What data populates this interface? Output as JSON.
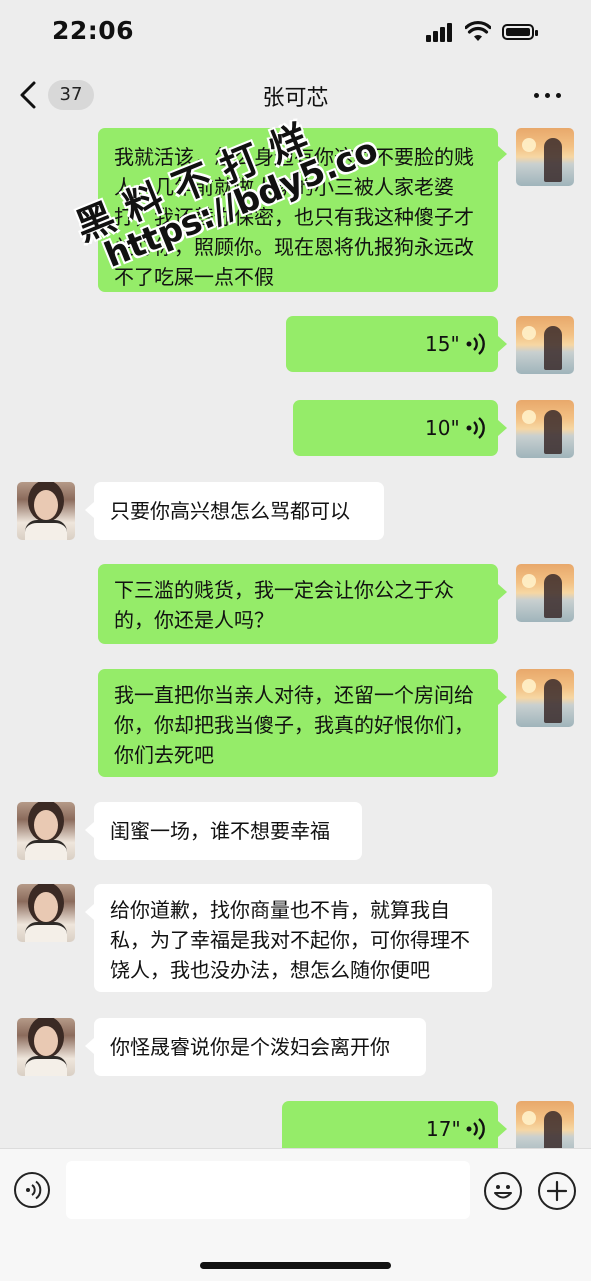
{
  "status_bar": {
    "time": "22:06"
  },
  "nav": {
    "unread_count": "37",
    "title": "张可芯"
  },
  "watermark": {
    "line1": "黑料不打烊",
    "line2": "https://bdy5.co"
  },
  "messages": [
    {
      "sender": "self",
      "type": "text",
      "text": "我就活该，怎么身边有你这种不要脸的贱人，几年前就做人家的小三被人家老婆打，我还替你保密，也只有我这种傻子才关心你，照顾你。现在恩将仇报狗永远改不了吃屎一点不假"
    },
    {
      "sender": "self",
      "type": "voice",
      "duration": "15\""
    },
    {
      "sender": "self",
      "type": "voice",
      "duration": "10\""
    },
    {
      "sender": "other",
      "type": "text",
      "text": "只要你高兴想怎么骂都可以"
    },
    {
      "sender": "self",
      "type": "text",
      "text": "下三滥的贱货，我一定会让你公之于众的，你还是人吗？"
    },
    {
      "sender": "self",
      "type": "text",
      "text": "我一直把你当亲人对待，还留一个房间给你，你却把我当傻子，我真的好恨你们，你们去死吧"
    },
    {
      "sender": "other",
      "type": "text",
      "text": "闺蜜一场，谁不想要幸福"
    },
    {
      "sender": "other",
      "type": "text",
      "text": "给你道歉，找你商量也不肯，就算我自私，为了幸福是我对不起你，可你得理不饶人，我也没办法，想怎么随你便吧"
    },
    {
      "sender": "other",
      "type": "text",
      "text": "你怪晟睿说你是个泼妇会离开你"
    },
    {
      "sender": "self",
      "type": "voice",
      "duration": "17\""
    }
  ],
  "input": {
    "placeholder": ""
  }
}
